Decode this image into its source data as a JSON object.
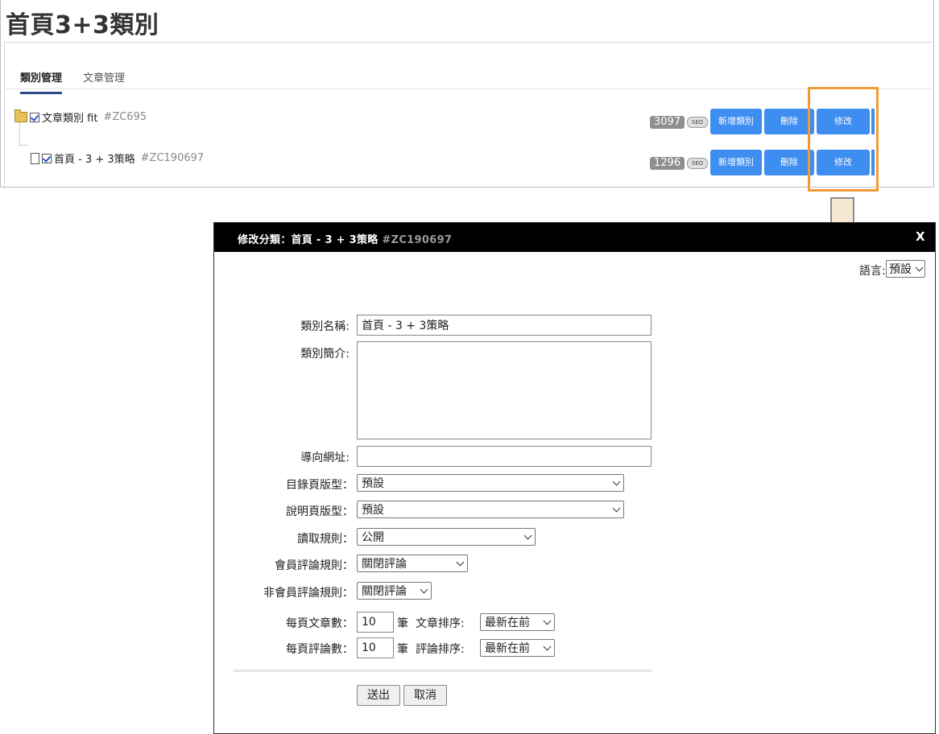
{
  "page": {
    "title": "首頁3+3類別"
  },
  "tabs": [
    {
      "label": "類別管理",
      "active": true
    },
    {
      "label": "文章管理",
      "active": false
    }
  ],
  "tree": [
    {
      "name": "文章類別 fit",
      "code": "#ZC695",
      "count": "3097",
      "seo": "SEO",
      "buttons": [
        "新增類別",
        "刪除",
        "修改"
      ]
    },
    {
      "name": "首頁 - 3 + 3策略",
      "code": "#ZC190697",
      "count": "1296",
      "seo": "SEO",
      "buttons": [
        "新增類別",
        "刪除",
        "修改"
      ]
    }
  ],
  "colors": {
    "accent_blue": "#3d8ef0",
    "highlight_orange": "#f39a36",
    "header_black": "#000000"
  },
  "modal": {
    "title": "修改分類：首頁 - 3 + 3策略",
    "code": "#ZC190697",
    "close_label": "X",
    "lang_label": "語言:",
    "lang_value": "預設",
    "fields": {
      "name_label": "類別名稱:",
      "name_value": "首頁 - 3 + 3策略",
      "intro_label": "類別簡介:",
      "intro_value": "",
      "url_label": "導向網址:",
      "url_value": "",
      "catalog_layout_label": "目錄頁版型：",
      "catalog_layout_value": "預設",
      "desc_layout_label": "說明頁版型：",
      "desc_layout_value": "預設",
      "read_rule_label": "讀取規則：",
      "read_rule_value": "公開",
      "member_comment_label": "會員評論規則：",
      "member_comment_value": "關閉評論",
      "guest_comment_label": "非會員評論規則：",
      "guest_comment_value": "關閉評論",
      "articles_per_page_label": "每頁文章數：",
      "articles_per_page_value": "10",
      "unit": "筆",
      "article_sort_label": "文章排序:",
      "article_sort_value": "最新在前",
      "comments_per_page_label": "每頁評論數：",
      "comments_per_page_value": "10",
      "comment_sort_label": "評論排序:",
      "comment_sort_value": "最新在前"
    },
    "submit_label": "送出",
    "cancel_label": "取消"
  }
}
